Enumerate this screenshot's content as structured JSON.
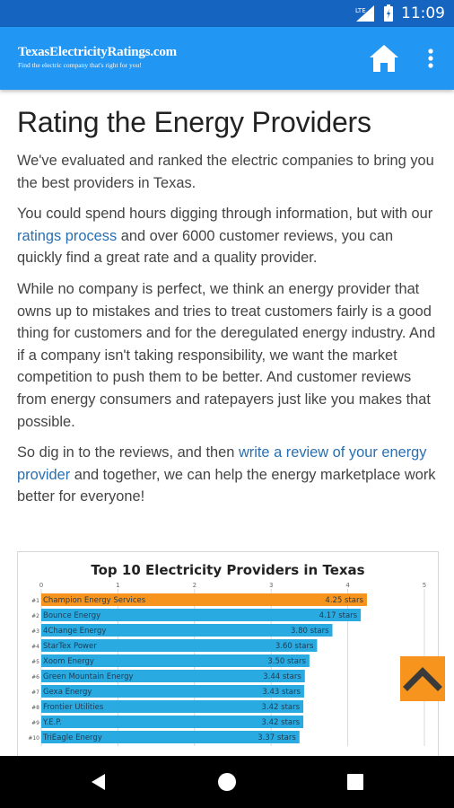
{
  "status_bar": {
    "time": "11:09",
    "network": "LTE"
  },
  "app_bar": {
    "site_name": "TexasElectricityRatings.com",
    "tagline": "Find the electric company that's right for you!"
  },
  "article": {
    "title": "Rating the Energy Providers",
    "p1": "We've evaluated and ranked the electric companies to bring you the best providers in Texas.",
    "p2_before": "You could spend hours digging through information, but with our ",
    "p2_link": "ratings process",
    "p2_after": " and over 6000 customer reviews, you can quickly find a great rate and a quality provider.",
    "p3": "While no company is perfect, we think an energy provider that owns up to mistakes and tries to treat customers fairly is a good thing for customers and for the deregulated energy industry. And if a company isn't taking responsibility, we want the market competition to push them to be better. And customer reviews from energy consumers and ratepayers just like you makes that possible.",
    "p4_before": "So dig in to the reviews, and then ",
    "p4_link": "write a review of your energy provider",
    "p4_after": " and together, we can help the energy marketplace work better for everyone!"
  },
  "chart_data": {
    "type": "bar",
    "orientation": "horizontal",
    "title": "Top 10 Electricity Providers in Texas",
    "xlim": [
      0,
      5
    ],
    "x_ticks": [
      "0",
      "1",
      "2",
      "3",
      "4",
      "5"
    ],
    "ranks": [
      "#1",
      "#2",
      "#3",
      "#4",
      "#5",
      "#6",
      "#7",
      "#8",
      "#9",
      "#10"
    ],
    "categories": [
      "Champion Energy Services",
      "Bounce Energy",
      "4Change Energy",
      "StarTex Power",
      "Xoom Energy",
      "Green Mountain Energy",
      "Gexa Energy",
      "Frontier Utilities",
      "Y.E.P.",
      "TriEagle Energy"
    ],
    "values": [
      4.25,
      4.17,
      3.8,
      3.6,
      3.5,
      3.44,
      3.43,
      3.42,
      3.42,
      3.37
    ],
    "value_labels": [
      "4.25 stars",
      "4.17 stars",
      "3.80 stars",
      "3.60 stars",
      "3.50 stars",
      "3.44 stars",
      "3.43 stars",
      "3.42 stars",
      "3.42 stars",
      "3.37 stars"
    ],
    "colors": {
      "highlight": "#F7941D",
      "bar": "#29ABE2"
    },
    "grid": true
  },
  "colors": {
    "app_bar": "#2196F3",
    "status_bar": "#1565C0",
    "link": "#2A6FB0",
    "accent": "#F7941D"
  },
  "icons": {
    "home": "home-icon",
    "menu": "more-vert-icon",
    "scroll_top": "chevron-up-icon",
    "back": "nav-back-icon",
    "home_nav": "nav-home-icon",
    "recents": "nav-recents-icon"
  }
}
